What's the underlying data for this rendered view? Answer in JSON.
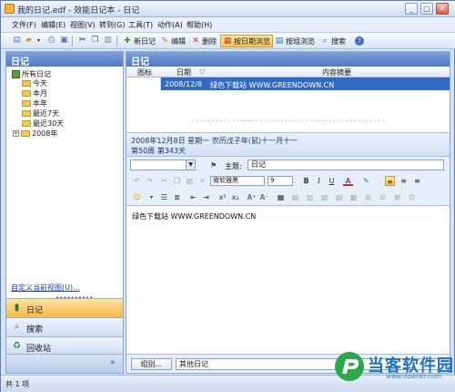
{
  "window": {
    "title": "我的日记.edf - 效能日记本 - 日记",
    "controls": {
      "minimize": "_",
      "maximize": "□",
      "close": "✕"
    }
  },
  "menu": [
    "文件(F)",
    "编辑(E)",
    "视图(V)",
    "转到(G)",
    "工具(T)",
    "动作(A)",
    "帮助(H)"
  ],
  "toolbar": {
    "new_diary": "新日记",
    "edit": "编辑",
    "delete": "删除",
    "by_date_view": "按日期浏览",
    "by_group_view": "按组浏览",
    "search": "搜索"
  },
  "left_pane": {
    "header": "日记",
    "tree": {
      "root": "所有日记",
      "items": [
        "今天",
        "本月",
        "本年",
        "最近7天",
        "最近30天"
      ],
      "year": "2008年"
    },
    "custom_view_link": "自定义当前视图(U)...",
    "nav": [
      "日记",
      "搜索",
      "回收站"
    ]
  },
  "right_pane": {
    "header": "日记",
    "columns": {
      "icon": "图标",
      "date": "日期",
      "summary": "内容摘要"
    },
    "rows": [
      {
        "date": "2008/12/8",
        "summary": "绿色下载站 WWW.GREENDOWN.CN"
      }
    ],
    "date_info": "2008年12月8日 星期一 农历戊子年(鼠)十一月十一",
    "week_info": "第50周 第343天",
    "subject_label": "主题:",
    "subject_value": "日记",
    "font_name": "微软雅黑",
    "font_size": "9",
    "content": "绿色下载站 WWW.GREENDOWN.CN",
    "group_button": "组别...",
    "group_value": "其他日记"
  },
  "status": {
    "count": "共 1 项"
  },
  "watermark": {
    "text": "当客软件园",
    "url": "www.downkr.com"
  },
  "colors": {
    "selection": "#316ac5",
    "header": "#4d78c0",
    "active_nav": "#f5b84a"
  }
}
